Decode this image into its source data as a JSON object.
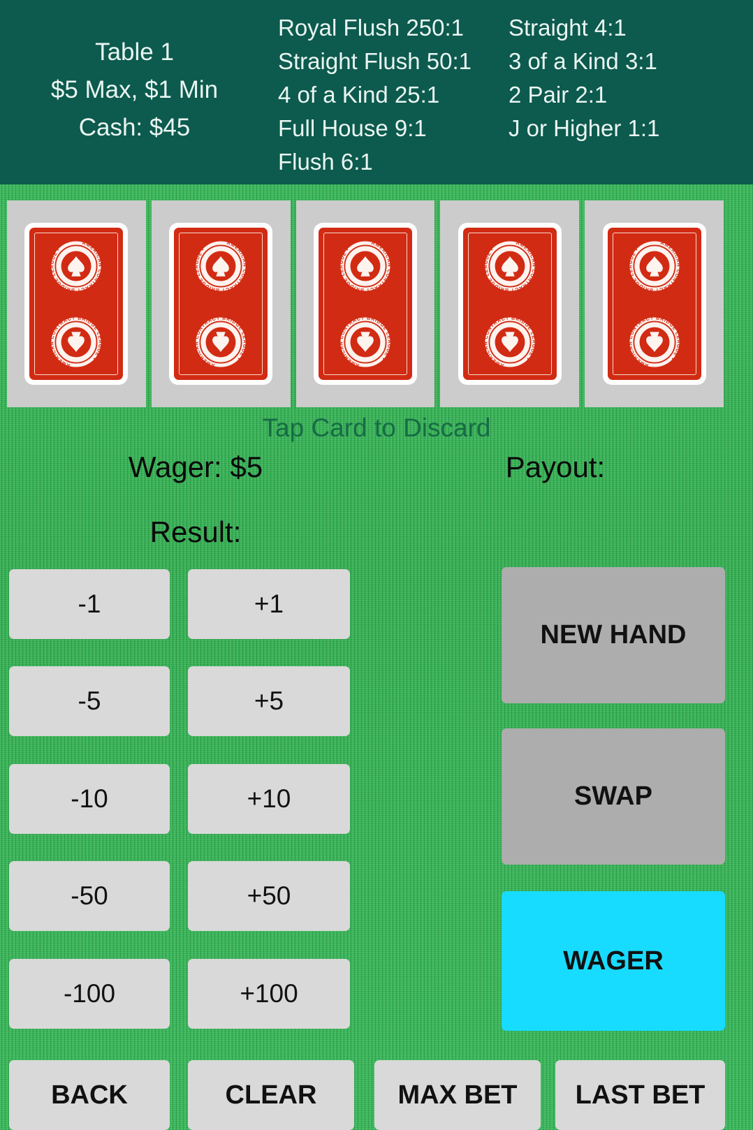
{
  "header": {
    "table_name": "Table 1",
    "limits": "$5 Max, $1 Min",
    "cash": "Cash: $45",
    "paytable_col1": [
      "Royal Flush 250:1",
      "Straight Flush 50:1",
      "4 of a Kind 25:1",
      "Full House 9:1",
      "Flush 6:1"
    ],
    "paytable_col2": [
      "Straight 4:1",
      "3 of a Kind 3:1",
      "2 Pair 2:1",
      "J or Higher 1:1"
    ]
  },
  "cards": {
    "count": 5,
    "face_down": true,
    "back_text": "AMERICAN CONTRACT BRIDGE LEAGUE",
    "slots": [
      {
        "name": "card-1",
        "state": "face-down"
      },
      {
        "name": "card-2",
        "state": "face-down"
      },
      {
        "name": "card-3",
        "state": "face-down"
      },
      {
        "name": "card-4",
        "state": "face-down"
      },
      {
        "name": "card-5",
        "state": "face-down"
      }
    ]
  },
  "hints": {
    "tap_to_discard": "Tap Card to Discard"
  },
  "status": {
    "wager": "Wager: $5",
    "payout": "Payout:",
    "result": "Result:"
  },
  "stepper": {
    "minus": [
      "-1",
      "-5",
      "-10",
      "-50",
      "-100"
    ],
    "plus": [
      "+1",
      "+5",
      "+10",
      "+50",
      "+100"
    ]
  },
  "actions": {
    "new_hand": "NEW HAND",
    "swap": "SWAP",
    "wager": "WAGER"
  },
  "bottom_bar": {
    "back": "BACK",
    "clear": "CLEAR",
    "max_bet": "MAX BET",
    "last_bet": "LAST BET"
  },
  "colors": {
    "header_bg": "#0d5a4e",
    "felt": "#32b555",
    "card_back_red": "#d22b13",
    "button_light": "#d9d9d9",
    "button_dark": "#adadad",
    "wager_cyan": "#18dcff",
    "hint_text": "#176b46"
  }
}
